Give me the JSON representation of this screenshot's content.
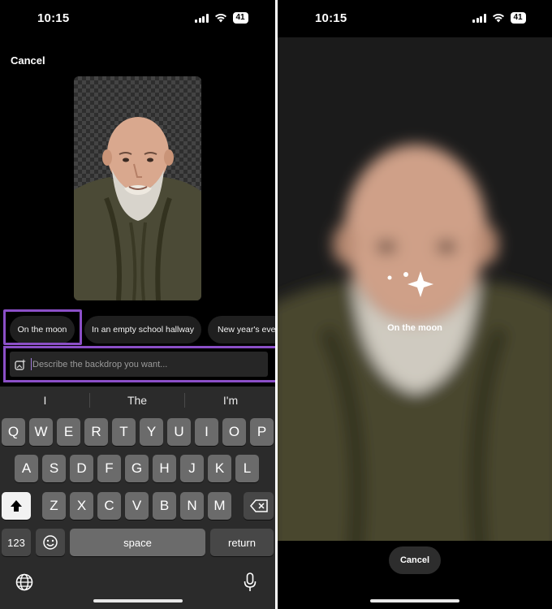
{
  "left_screen": {
    "status": {
      "time": "10:15",
      "battery": "41"
    },
    "cancel_label": "Cancel",
    "suggestions": [
      {
        "label": "On the moon"
      },
      {
        "label": "In an empty school hallway"
      },
      {
        "label": "New year's eve"
      }
    ],
    "input": {
      "placeholder": "Describe the backdrop you want...",
      "value": ""
    },
    "predictions": [
      "I",
      "The",
      "I'm"
    ],
    "keyboard": {
      "row1": [
        "Q",
        "W",
        "E",
        "R",
        "T",
        "Y",
        "U",
        "I",
        "O",
        "P"
      ],
      "row2": [
        "A",
        "S",
        "D",
        "F",
        "G",
        "H",
        "J",
        "K",
        "L"
      ],
      "row3": [
        "Z",
        "X",
        "C",
        "V",
        "B",
        "N",
        "M"
      ],
      "numbers_label": "123",
      "space_label": "space",
      "return_label": "return"
    },
    "highlight_color": "#8b4fc7"
  },
  "right_screen": {
    "status": {
      "time": "10:15",
      "battery": "41"
    },
    "generating_caption": "On the moon",
    "cancel_label": "Cancel"
  }
}
